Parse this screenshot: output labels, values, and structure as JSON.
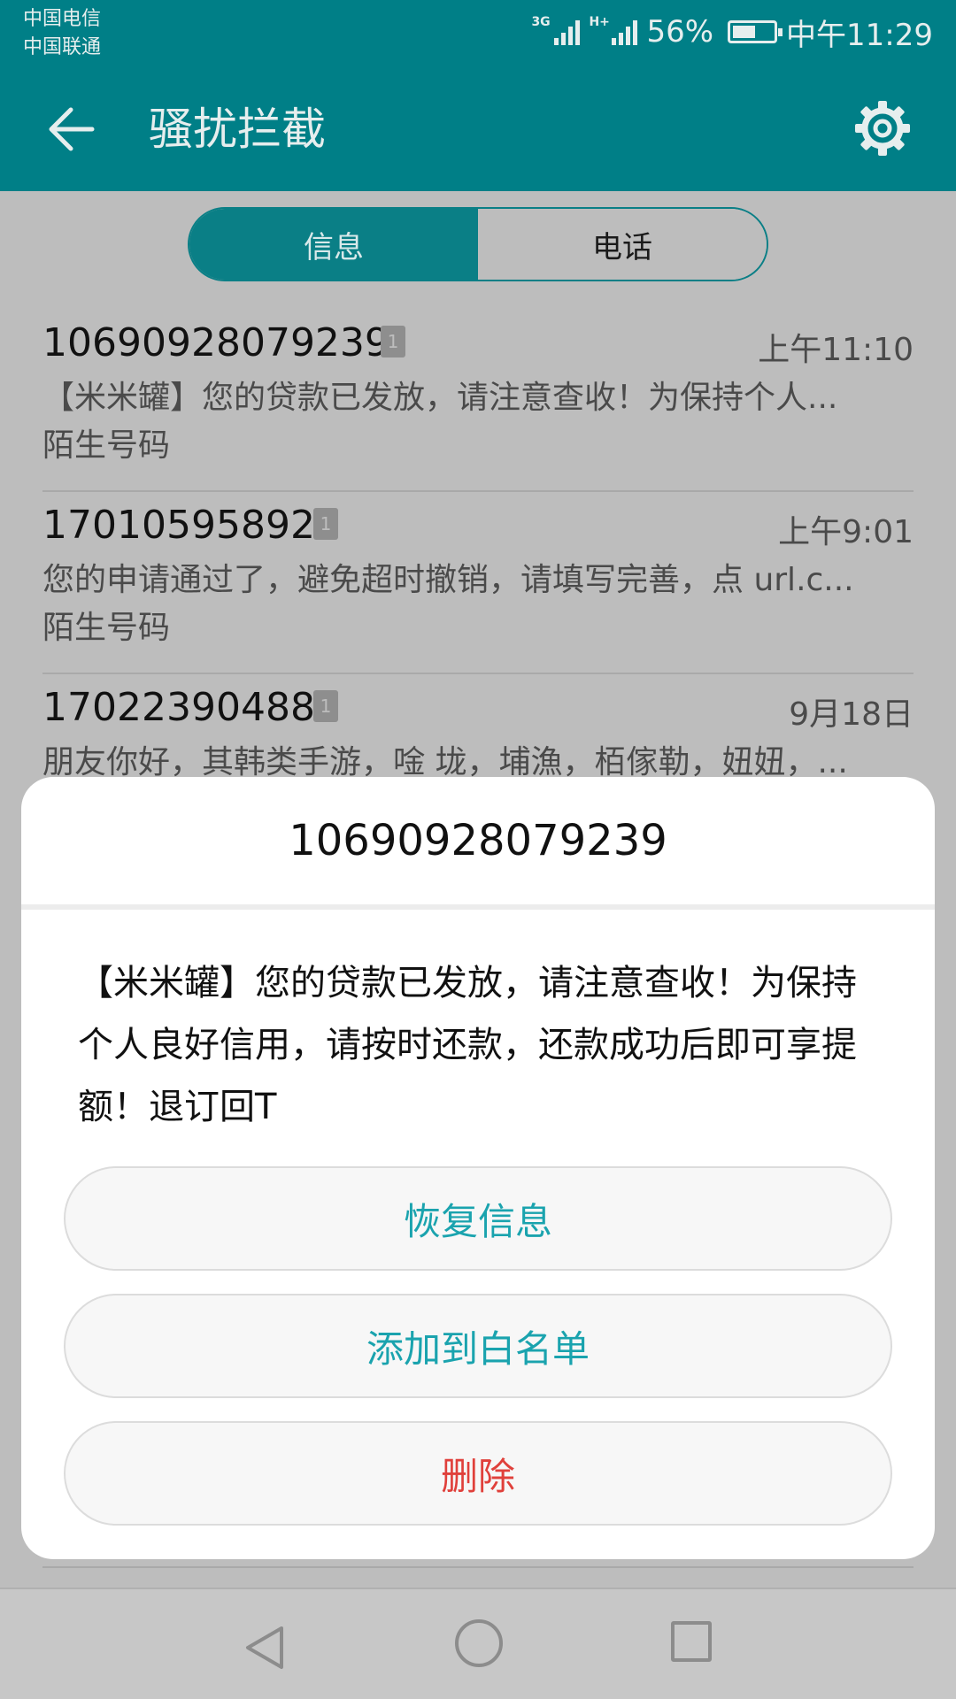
{
  "status_bar": {
    "carrier_1": "中国电信",
    "carrier_2": "中国联通",
    "signal_1_tag": "3G",
    "signal_2_tag": "H+",
    "battery_percent": "56%",
    "battery_level": 0.56,
    "time": "中午11:29"
  },
  "app_bar": {
    "title": "骚扰拦截",
    "back_icon": "arrow-left-icon",
    "settings_icon": "gear-icon"
  },
  "tabs": [
    {
      "label": "信息",
      "active": true
    },
    {
      "label": "电话",
      "active": false
    }
  ],
  "messages": [
    {
      "number": "10690928079239",
      "sim": "1",
      "time": "上午11:10",
      "preview": "【米米罐】您的贷款已发放，请注意查收！为保持个人...",
      "label": "陌生号码"
    },
    {
      "number": "17010595892",
      "sim": "1",
      "time": "上午9:01",
      "preview": "您的申请通过了，避免超时撤销，请填写完善，点 url.c...",
      "label": "陌生号码"
    },
    {
      "number": "17022390488",
      "sim": "1",
      "time": "9月18日",
      "preview": "朋友你好，其韩类手游，唫 垅，埔漁，栢傢勒，妞妞，...",
      "label": ""
    }
  ],
  "dialog": {
    "title": "10690928079239",
    "body": "【米米罐】您的贷款已发放，请注意查收！为保持个人良好信用，请按时还款，还款成功后即可享提额！退订回T",
    "restore_label": "恢复信息",
    "whitelist_label": "添加到白名单",
    "delete_label": "删除"
  },
  "colors": {
    "accent": "#1aa3ae",
    "danger": "#e0403b",
    "appbar_dimmed": "#007f87"
  }
}
